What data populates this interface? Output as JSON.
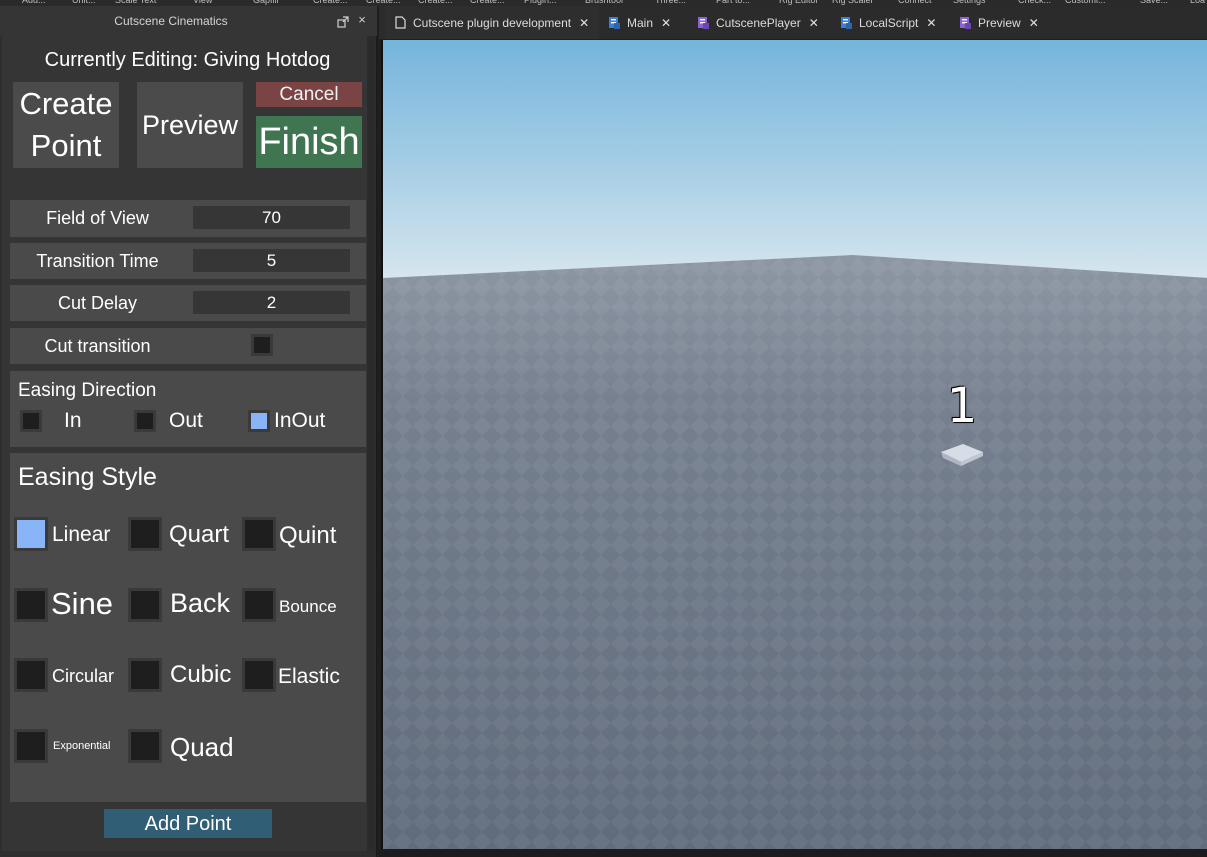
{
  "toolbar_strip": [
    "Add...",
    "Unit...",
    "Scale Text",
    "View",
    "Gapfill",
    "Create...",
    "Create...",
    "Create...",
    "Create...",
    "Plugin...",
    "Brushtool",
    "Three...",
    "Part to...",
    "Rig Editor",
    "Rig Scaler",
    "Connect",
    "Settings",
    "Check...",
    "Customi...",
    "Save...",
    "Loa"
  ],
  "panel": {
    "title": "Cutscene Cinematics",
    "close_glyph": "×",
    "editing": "Currently Editing: Giving Hotdog",
    "buttons": {
      "create_point": "Create\nPoint",
      "preview": "Preview",
      "cancel": "Cancel",
      "finish": "Finish"
    },
    "fields": [
      {
        "label": "Field of View",
        "value": "70"
      },
      {
        "label": "Transition Time",
        "value": "5"
      },
      {
        "label": "Cut Delay",
        "value": "2"
      }
    ],
    "cut_transition": {
      "label": "Cut transition",
      "checked": false
    },
    "easing_direction": {
      "title": "Easing Direction",
      "options": [
        {
          "label": "In",
          "checked": false
        },
        {
          "label": "Out",
          "checked": false
        },
        {
          "label": "InOut",
          "checked": true
        }
      ]
    },
    "easing_style": {
      "title": "Easing Style",
      "options": [
        {
          "label": "Linear",
          "checked": true
        },
        {
          "label": "Quart",
          "checked": false
        },
        {
          "label": "Quint",
          "checked": false
        },
        {
          "label": "Sine",
          "checked": false
        },
        {
          "label": "Back",
          "checked": false
        },
        {
          "label": "Bounce",
          "checked": false
        },
        {
          "label": "Circular",
          "checked": false
        },
        {
          "label": "Cubic",
          "checked": false
        },
        {
          "label": "Elastic",
          "checked": false
        },
        {
          "label": "Exponential",
          "checked": false
        },
        {
          "label": "Quad",
          "checked": false
        }
      ]
    },
    "add_point": "Add Point"
  },
  "tabs": [
    {
      "label": "Cutscene plugin development",
      "icon": "place-file-icon",
      "active": true
    },
    {
      "label": "Main",
      "icon": "script-icon",
      "active": false
    },
    {
      "label": "CutscenePlayer",
      "icon": "module-script-icon",
      "active": false
    },
    {
      "label": "LocalScript",
      "icon": "script-icon",
      "active": false
    },
    {
      "label": "Preview",
      "icon": "module-script-icon",
      "active": false
    }
  ],
  "tab_close_glyph": "✕",
  "viewport": {
    "marker_label": "1"
  },
  "colors": {
    "panel_bg": "#353535",
    "row_bg": "#4a4a4a",
    "cancel": "#7a4444",
    "finish": "#3f7550",
    "add_point": "#2f5e75",
    "checked": "#8ab4f8",
    "sky_top": "#74b5dc",
    "baseplate": "#6b7686"
  }
}
